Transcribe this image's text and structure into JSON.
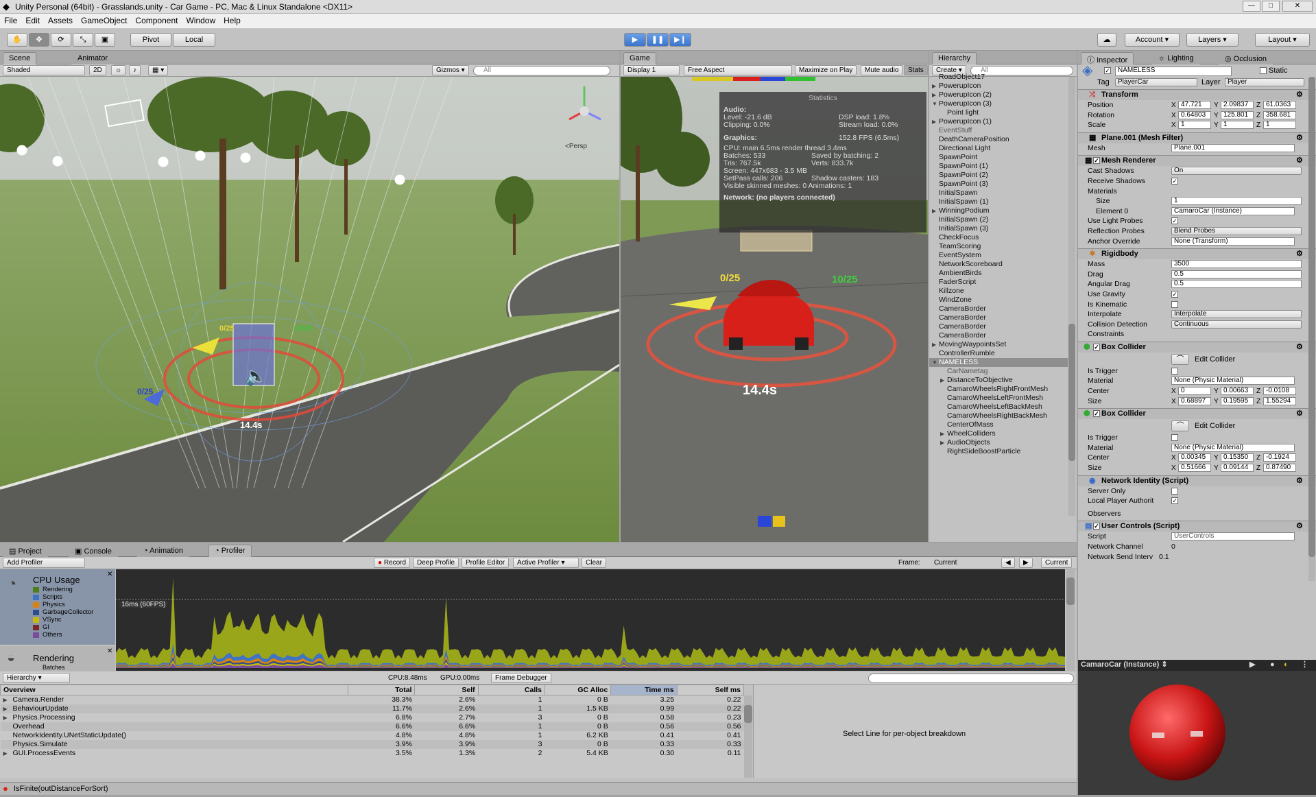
{
  "window": {
    "title": "Unity Personal (64bit) - Grasslands.unity - Car Game - PC, Mac & Linux Standalone <DX11>",
    "min": "—",
    "max": "□",
    "close": "✕"
  },
  "menu": [
    "File",
    "Edit",
    "Assets",
    "GameObject",
    "Component",
    "Window",
    "Help"
  ],
  "toolbar": {
    "pivot": "Pivot",
    "local": "Local",
    "account": "Account",
    "layers": "Layers",
    "layout": "Layout"
  },
  "scene": {
    "tab_scene": "Scene",
    "tab_animator": "Animator",
    "shaded": "Shaded",
    "mode2d": "2D",
    "gizmos": "Gizmos",
    "search_placeholder": "All",
    "persp": "<Persp",
    "overlay_score1": "0/25",
    "overlay_score2": "0/25",
    "overlay_score3": "10/25",
    "timer": "14.4s"
  },
  "game": {
    "tab": "Game",
    "display": "Display 1",
    "aspect": "Free Aspect",
    "maximize": "Maximize on Play",
    "mute": "Mute audio",
    "stats": "Stats",
    "score_left": "0/25",
    "score_right": "10/25",
    "timer": "14.4s",
    "statistics": {
      "title": "Statistics",
      "audio_h": "Audio:",
      "level": "Level: -21.6 dB",
      "dsp": "DSP load: 1.8%",
      "clipping": "Clipping: 0.0%",
      "stream": "Stream load: 0.0%",
      "graphics_h": "Graphics:",
      "fps": "152.8 FPS (6.5ms)",
      "cpu": "CPU: main 6.5ms  render thread 3.4ms",
      "batches": "Batches: 533",
      "saved": "Saved by batching: 2",
      "tris": "Tris: 767.5k",
      "verts": "Verts: 833.7k",
      "screen": "Screen: 447x683 - 3.5 MB",
      "setpass": "SetPass calls: 206",
      "shadow": "Shadow casters: 183",
      "skinned": "Visible skinned meshes: 0  Animations: 1",
      "network": "Network: (no players connected)"
    }
  },
  "hierarchy": {
    "tab": "Hierarchy",
    "create": "Create",
    "search_placeholder": "All",
    "items": [
      {
        "name": "RoadObject17",
        "kind": "item"
      },
      {
        "name": "PowerupIcon",
        "kind": "arrow"
      },
      {
        "name": "PowerupIcon (2)",
        "kind": "arrow"
      },
      {
        "name": "PowerupIcon (3)",
        "kind": "open"
      },
      {
        "name": "Point light",
        "kind": "child"
      },
      {
        "name": "PowerupIcon (1)",
        "kind": "arrow"
      },
      {
        "name": "EventStuff",
        "kind": "grey"
      },
      {
        "name": "DeathCameraPosition",
        "kind": "item"
      },
      {
        "name": "Directional Light",
        "kind": "item"
      },
      {
        "name": "SpawnPoint",
        "kind": "item"
      },
      {
        "name": "SpawnPoint (1)",
        "kind": "item"
      },
      {
        "name": "SpawnPoint (2)",
        "kind": "item"
      },
      {
        "name": "SpawnPoint (3)",
        "kind": "item"
      },
      {
        "name": "InitialSpawn",
        "kind": "item"
      },
      {
        "name": "InitialSpawn (1)",
        "kind": "item"
      },
      {
        "name": "WinningPodium",
        "kind": "arrow"
      },
      {
        "name": "InitialSpawn (2)",
        "kind": "item"
      },
      {
        "name": "InitialSpawn (3)",
        "kind": "item"
      },
      {
        "name": "CheckFocus",
        "kind": "item"
      },
      {
        "name": "TeamScoring",
        "kind": "item"
      },
      {
        "name": "EventSystem",
        "kind": "item"
      },
      {
        "name": "NetworkScoreboard",
        "kind": "item"
      },
      {
        "name": "AmbientBirds",
        "kind": "item"
      },
      {
        "name": "FaderScript",
        "kind": "item"
      },
      {
        "name": "Killzone",
        "kind": "item"
      },
      {
        "name": "WindZone",
        "kind": "item"
      },
      {
        "name": "CameraBorder",
        "kind": "item"
      },
      {
        "name": "CameraBorder",
        "kind": "item"
      },
      {
        "name": "CameraBorder",
        "kind": "item"
      },
      {
        "name": "CameraBorder",
        "kind": "item"
      },
      {
        "name": "MovingWaypointsSet",
        "kind": "arrow"
      },
      {
        "name": "ControllerRumble",
        "kind": "item"
      },
      {
        "name": "NAMELESS",
        "kind": "selected"
      },
      {
        "name": "CarNametag",
        "kind": "childgrey"
      },
      {
        "name": "DistanceToObjective",
        "kind": "childarrow"
      },
      {
        "name": "CamaroWheelsRightFrontMesh",
        "kind": "child"
      },
      {
        "name": "CamaroWheelsLeftFrontMesh",
        "kind": "child"
      },
      {
        "name": "CamaroWheelsLeftBackMesh",
        "kind": "child"
      },
      {
        "name": "CamaroWheelsRightBackMesh",
        "kind": "child"
      },
      {
        "name": "CenterOfMass",
        "kind": "child"
      },
      {
        "name": "WheelColliders",
        "kind": "childarrow"
      },
      {
        "name": "AudioObjects",
        "kind": "childarrow"
      },
      {
        "name": "RightSideBoostParticle",
        "kind": "child"
      }
    ]
  },
  "inspector": {
    "tab_inspector": "Inspector",
    "tab_lighting": "Lighting",
    "tab_occlusion": "Occlusion",
    "object_name": "NAMELESS",
    "static": "Static",
    "tag_label": "Tag",
    "tag": "PlayerCar",
    "layer_label": "Layer",
    "layer": "Player",
    "transform": {
      "title": "Transform",
      "position_label": "Position",
      "position": [
        "47.721",
        "2.09837",
        "61.0363"
      ],
      "rotation_label": "Rotation",
      "rotation": [
        "0.64803",
        "125.801",
        "358.681"
      ],
      "scale_label": "Scale",
      "scale": [
        "1",
        "1",
        "1"
      ]
    },
    "mesh_filter": {
      "title": "Plane.001 (Mesh Filter)",
      "mesh_label": "Mesh",
      "mesh": "Plane.001"
    },
    "mesh_renderer": {
      "title": "Mesh Renderer",
      "cast_label": "Cast Shadows",
      "cast": "On",
      "receive_label": "Receive Shadows",
      "materials_label": "Materials",
      "size_label": "Size",
      "size": "1",
      "element0_label": "Element 0",
      "element0": "CamaroCar (Instance)",
      "lightprobes_label": "Use Light Probes",
      "reflprobes_label": "Reflection Probes",
      "reflprobes": "Blend Probes",
      "anchor_label": "Anchor Override",
      "anchor": "None (Transform)"
    },
    "rigidbody": {
      "title": "Rigidbody",
      "mass_label": "Mass",
      "mass": "3500",
      "drag_label": "Drag",
      "drag": "0.5",
      "angdrag_label": "Angular Drag",
      "angdrag": "0.5",
      "gravity_label": "Use Gravity",
      "kinematic_label": "Is Kinematic",
      "interp_label": "Interpolate",
      "interp": "Interpolate",
      "collision_label": "Collision Detection",
      "collision": "Continuous",
      "constraints_label": "Constraints"
    },
    "box1": {
      "title": "Box Collider",
      "edit": "Edit Collider",
      "trigger_label": "Is Trigger",
      "material_label": "Material",
      "material": "None (Physic Material)",
      "center_label": "Center",
      "center": [
        "0",
        "0.00663",
        "-0.0108"
      ],
      "size_label": "Size",
      "size": [
        "0.68897",
        "0.19595",
        "1.55294"
      ]
    },
    "box2": {
      "title": "Box Collider",
      "edit": "Edit Collider",
      "trigger_label": "Is Trigger",
      "material_label": "Material",
      "material": "None (Physic Material)",
      "center_label": "Center",
      "center": [
        "0.00345",
        "0.15350",
        "-0.1924"
      ],
      "size_label": "Size",
      "size": [
        "0.51666",
        "0.09144",
        "0.87490"
      ]
    },
    "netid": {
      "title": "Network Identity (Script)",
      "server_label": "Server Only",
      "local_label": "Local Player Authorit",
      "observers_label": "Observers"
    },
    "usercontrols": {
      "title": "User Controls (Script)",
      "script_label": "Script",
      "script": "UserControls",
      "channel_label": "Network Channel",
      "channel": "0",
      "interval_label": "Network Send Interv",
      "interval": "0.1"
    },
    "preview_title": "CamaroCar (Instance)"
  },
  "profiler": {
    "tab_project": "Project",
    "tab_console": "Console",
    "tab_animation": "Animation",
    "tab_profiler": "Profiler",
    "add": "Add Profiler",
    "record": "Record",
    "deep": "Deep Profile",
    "editor": "Profile Editor",
    "active": "Active Profiler",
    "clear": "Clear",
    "frame_label": "Frame:",
    "frame": "Current",
    "current": "Current",
    "cpu_title": "CPU Usage",
    "cpu_legend": [
      "Rendering",
      "Scripts",
      "Physics",
      "GarbageCollector",
      "VSync",
      "GI",
      "Others"
    ],
    "render_title": "Rendering",
    "render_sub": "Batches",
    "fps_label": "16ms (60FPS)",
    "view": "Hierarchy",
    "cpu_stat": "CPU:8.48ms",
    "gpu_stat": "GPU:0.00ms",
    "frame_debugger": "Frame Debugger",
    "columns": [
      "Overview",
      "Total",
      "Self",
      "Calls",
      "GC Alloc",
      "Time ms",
      "Self ms"
    ],
    "rows": [
      {
        "name": "Camera.Render",
        "total": "38.3%",
        "self": "2.6%",
        "calls": "1",
        "gc": "0 B",
        "time": "3.25",
        "selfms": "0.22",
        "arrow": true,
        "extra": ""
      },
      {
        "name": "BehaviourUpdate",
        "total": "11.7%",
        "self": "2.6%",
        "calls": "1",
        "gc": "1.5 KB",
        "time": "0.99",
        "selfms": "0.22",
        "arrow": true,
        "extra": "1"
      },
      {
        "name": "Physics.Processing",
        "total": "6.8%",
        "self": "2.7%",
        "calls": "3",
        "gc": "0 B",
        "time": "0.58",
        "selfms": "0.23",
        "arrow": true,
        "extra": ""
      },
      {
        "name": "Overhead",
        "total": "6.6%",
        "self": "6.6%",
        "calls": "1",
        "gc": "0 B",
        "time": "0.56",
        "selfms": "0.56",
        "arrow": false,
        "extra": ""
      },
      {
        "name": "NetworkIdentity.UNetStaticUpdate()",
        "total": "4.8%",
        "self": "4.8%",
        "calls": "1",
        "gc": "6.2 KB",
        "time": "0.41",
        "selfms": "0.41",
        "arrow": false,
        "extra": ""
      },
      {
        "name": "Physics.Simulate",
        "total": "3.9%",
        "self": "3.9%",
        "calls": "3",
        "gc": "0 B",
        "time": "0.33",
        "selfms": "0.33",
        "arrow": false,
        "extra": ""
      },
      {
        "name": "GUI.ProcessEvents",
        "total": "3.5%",
        "self": "1.3%",
        "calls": "2",
        "gc": "5.4 KB",
        "time": "0.30",
        "selfms": "0.11",
        "arrow": true,
        "extra": ""
      }
    ],
    "breakdown": "Select Line for per-object breakdown"
  },
  "status": {
    "message": "IsFinite(outDistanceForSort)"
  },
  "colors": {
    "rendering": "#4c7f1b",
    "scripts": "#3f74c4",
    "physics": "#d8820f",
    "gc": "#2d4d8e",
    "vsync": "#c9b70d",
    "gi": "#7a2626",
    "others": "#7a4c9b"
  }
}
